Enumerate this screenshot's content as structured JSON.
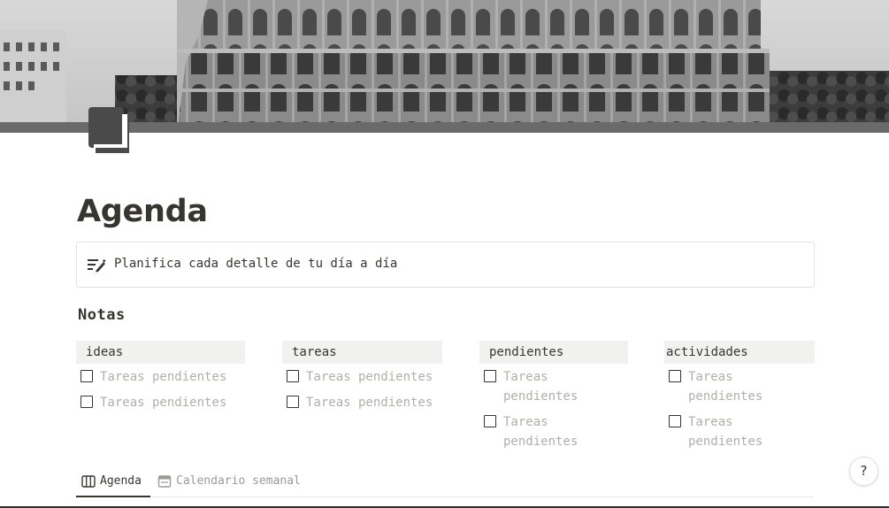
{
  "page": {
    "title": "Agenda",
    "callout_text": "Planifica cada detalle de tu día a día"
  },
  "notes": {
    "heading": "Notas",
    "columns": [
      {
        "label": "ideas",
        "items": [
          "Tareas pendientes",
          "Tareas pendientes"
        ]
      },
      {
        "label": "tareas",
        "items": [
          "Tareas pendientes",
          "Tareas pendientes"
        ]
      },
      {
        "label": "pendientes",
        "items": [
          "Tareas pendientes",
          "Tareas pendientes"
        ]
      },
      {
        "label": "actividades",
        "items": [
          "Tareas pendientes",
          "Tareas pendientes"
        ]
      }
    ]
  },
  "views": {
    "tabs": [
      {
        "label": "Agenda",
        "icon": "board-icon",
        "active": true
      },
      {
        "label": "Calendario semanal",
        "icon": "calendar-icon",
        "active": false
      }
    ]
  },
  "help_label": "?",
  "colors": {
    "text": "#37352f",
    "placeholder": "#b0afab",
    "header_bg": "#f1f1ef",
    "muted": "#9b9a97"
  }
}
